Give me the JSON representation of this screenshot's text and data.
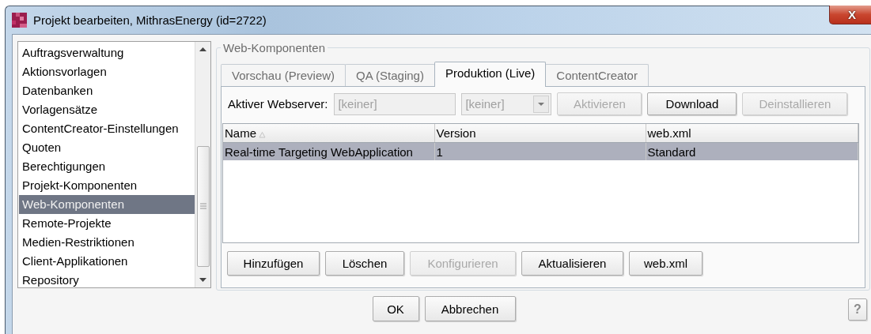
{
  "window": {
    "title": "Projekt bearbeiten, MithrasEnergy (id=2722)",
    "close_label": "X"
  },
  "sidebar": {
    "items": [
      {
        "label": "Auftragsverwaltung",
        "selected": false
      },
      {
        "label": "Aktionsvorlagen",
        "selected": false
      },
      {
        "label": "Datenbanken",
        "selected": false
      },
      {
        "label": "Vorlagensätze",
        "selected": false
      },
      {
        "label": "ContentCreator-Einstellungen",
        "selected": false
      },
      {
        "label": "Quoten",
        "selected": false
      },
      {
        "label": "Berechtigungen",
        "selected": false
      },
      {
        "label": "Projekt-Komponenten",
        "selected": false
      },
      {
        "label": "Web-Komponenten",
        "selected": true
      },
      {
        "label": "Remote-Projekte",
        "selected": false
      },
      {
        "label": "Medien-Restriktionen",
        "selected": false
      },
      {
        "label": "Client-Applikationen",
        "selected": false
      },
      {
        "label": "Repository",
        "selected": false
      }
    ]
  },
  "group": {
    "title": "Web-Komponenten"
  },
  "tabs": [
    {
      "label": "Vorschau (Preview)",
      "selected": false
    },
    {
      "label": "QA (Staging)",
      "selected": false
    },
    {
      "label": "Produktion (Live)",
      "selected": true
    },
    {
      "label": "ContentCreator",
      "selected": false
    }
  ],
  "webserver": {
    "label": "Aktiver Webserver:",
    "field_value": "[keiner]",
    "field_disabled": true,
    "dropdown_value": "[keiner]",
    "dropdown_disabled": true
  },
  "toolbar_buttons": [
    {
      "label": "Aktivieren",
      "disabled": true
    },
    {
      "label": "Download",
      "disabled": false
    },
    {
      "label": "Deinstallieren",
      "disabled": true
    }
  ],
  "table": {
    "columns": [
      {
        "label": "Name",
        "sorted": true
      },
      {
        "label": "Version",
        "sorted": false
      },
      {
        "label": "web.xml",
        "sorted": false
      }
    ],
    "rows": [
      {
        "cells": [
          "Real-time Targeting WebApplication",
          "1",
          "Standard"
        ],
        "selected": true
      }
    ]
  },
  "table_buttons": [
    {
      "label": "Hinzufügen",
      "disabled": false
    },
    {
      "label": "Löschen",
      "disabled": false
    },
    {
      "label": "Konfigurieren",
      "disabled": true
    },
    {
      "label": "Aktualisieren",
      "disabled": false
    },
    {
      "label": "web.xml",
      "disabled": false
    }
  ],
  "dialog_buttons": [
    {
      "label": "OK"
    },
    {
      "label": "Abbrechen"
    }
  ],
  "help": {
    "label": "?"
  }
}
